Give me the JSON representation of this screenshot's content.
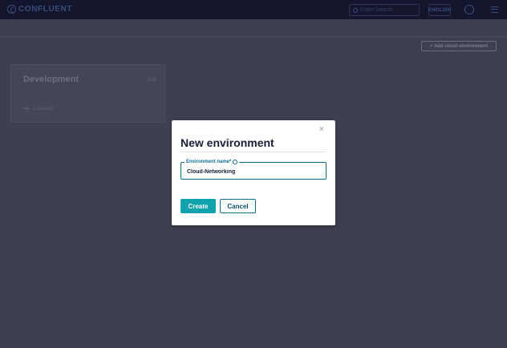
{
  "header": {
    "logo_text": "CONFLUENT",
    "search_placeholder": "Enter Search",
    "language": "ENGLISH",
    "icons": [
      "help-icon",
      "menu-icon"
    ]
  },
  "toolbar": {
    "add_environment_label": "+ Add cloud environment"
  },
  "environments": [
    {
      "name": "Development",
      "edit_label": "Edit",
      "clusters_label": "0 clusters"
    }
  ],
  "modal": {
    "title": "New environment",
    "close_symbol": "×",
    "field": {
      "label": "Environment name*",
      "value": "Cloud-Networking"
    },
    "create_label": "Create",
    "cancel_label": "Cancel"
  },
  "colors": {
    "accent": "#0fa3ad",
    "link": "#0b6f8c",
    "overlay_bg": "#3e4051",
    "topbar_bg": "#14162d"
  }
}
